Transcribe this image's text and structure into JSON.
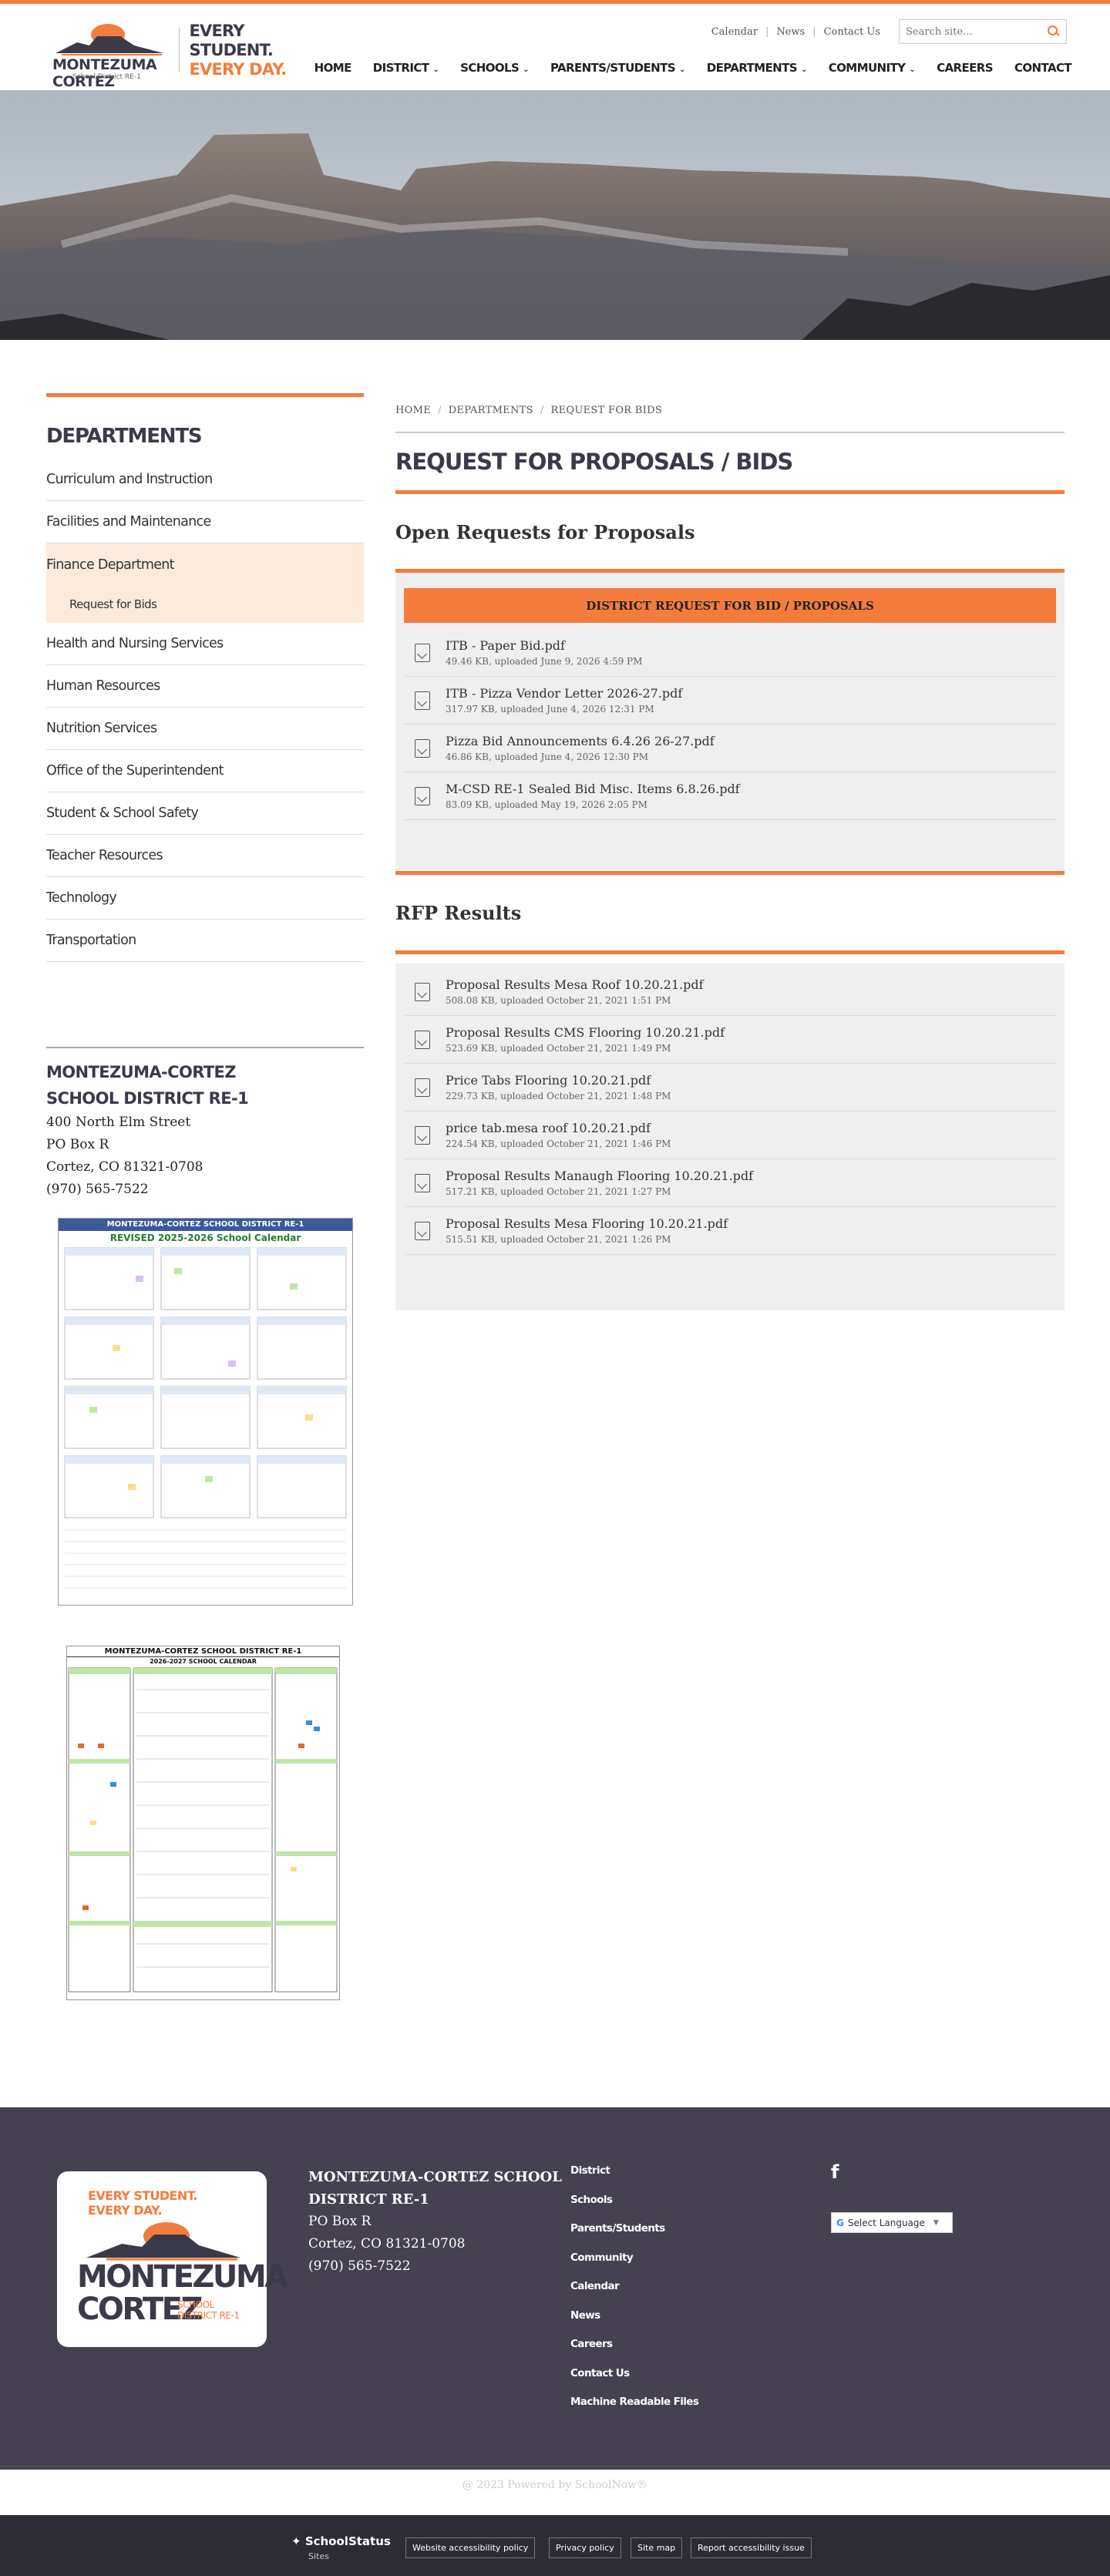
{
  "header": {
    "logo_name": "MONTEZUMA CORTEZ",
    "logo_sub": "School District RE-1",
    "tagline_1": "EVERY STUDENT.",
    "tagline_2": "EVERY DAY.",
    "util_links": [
      "Calendar",
      "News",
      "Contact Us"
    ],
    "search_placeholder": "Search site...",
    "nav": [
      {
        "label": "HOME",
        "dropdown": false
      },
      {
        "label": "DISTRICT",
        "dropdown": true
      },
      {
        "label": "SCHOOLS",
        "dropdown": true
      },
      {
        "label": "PARENTS/STUDENTS",
        "dropdown": true
      },
      {
        "label": "DEPARTMENTS",
        "dropdown": true
      },
      {
        "label": "COMMUNITY",
        "dropdown": true
      },
      {
        "label": "CAREERS",
        "dropdown": false
      },
      {
        "label": "CONTACT",
        "dropdown": false
      }
    ]
  },
  "breadcrumb": [
    "HOME",
    "DEPARTMENTS",
    "REQUEST FOR BIDS"
  ],
  "page_title": "REQUEST FOR PROPOSALS / BIDS",
  "open_section": {
    "heading": "Open Requests for Proposals",
    "panel_title": "DISTRICT REQUEST FOR BID / PROPOSALS",
    "files": [
      {
        "name": "ITB - Paper Bid.pdf",
        "meta": "49.46 KB, uploaded June 9, 2026 4:59 PM"
      },
      {
        "name": "ITB - Pizza Vendor Letter 2026-27.pdf",
        "meta": "317.97 KB, uploaded June 4, 2026 12:31 PM"
      },
      {
        "name": "Pizza Bid Announcements 6.4.26 26-27.pdf",
        "meta": "46.86 KB, uploaded June 4, 2026 12:30 PM"
      },
      {
        "name": "M-CSD RE-1 Sealed Bid Misc. Items 6.8.26.pdf",
        "meta": "83.09 KB, uploaded May 19, 2026 2:05 PM"
      }
    ]
  },
  "results_section": {
    "heading": "RFP Results",
    "files": [
      {
        "name": "Proposal Results Mesa Roof 10.20.21.pdf",
        "meta": "508.08 KB, uploaded October 21, 2021 1:51 PM"
      },
      {
        "name": "Proposal Results CMS Flooring 10.20.21.pdf",
        "meta": "523.69 KB, uploaded October 21, 2021 1:49 PM"
      },
      {
        "name": "Price Tabs Flooring 10.20.21.pdf",
        "meta": "229.73 KB, uploaded October 21, 2021 1:48 PM"
      },
      {
        "name": "price tab.mesa roof 10.20.21.pdf",
        "meta": "224.54 KB, uploaded October 21, 2021 1:46 PM"
      },
      {
        "name": "Proposal Results Manaugh Flooring 10.20.21.pdf",
        "meta": "517.21 KB, uploaded October 21, 2021 1:27 PM"
      },
      {
        "name": "Proposal Results Mesa Flooring 10.20.21.pdf",
        "meta": "515.51 KB, uploaded October 21, 2021 1:26 PM"
      }
    ]
  },
  "sidebar": {
    "title": "DEPARTMENTS",
    "items_before": [
      "Curriculum and Instruction",
      "Facilities and Maintenance"
    ],
    "active_item": "Finance Department",
    "active_sub": "Request for Bids",
    "items_after": [
      "Health and Nursing Services",
      "Human Resources",
      "Nutrition Services",
      "Office of the Superintendent",
      "Student & School Safety",
      "Teacher Resources",
      "Technology",
      "Transportation"
    ],
    "address_title_1": "MONTEZUMA-CORTEZ",
    "address_title_2": "SCHOOL DISTRICT RE-1",
    "address_lines": [
      "400 North Elm Street",
      "PO Box R",
      "Cortez, CO 81321-0708",
      "(970) 565-7522"
    ]
  },
  "calendar1": {
    "title": "MONTEZUMA-CORTEZ SCHOOL DISTRICT RE-1",
    "subtitle": "REVISED 2025-2026 School Calendar"
  },
  "calendar2": {
    "title": "MONTEZUMA-CORTEZ SCHOOL DISTRICT RE-1",
    "subtitle": "2026-2027 SCHOOL CALENDAR"
  },
  "footer": {
    "logo_tagline_1": "EVERY STUDENT.",
    "logo_tagline_2": "EVERY DAY.",
    "logo_word_1": "MONTEZUMA",
    "logo_word_2": "CORTEZ",
    "logo_side_1": "SCHOOL",
    "logo_side_2": "DISTRICT RE-1",
    "address_title_1": "MONTEZUMA-CORTEZ SCHOOL",
    "address_title_2": "DISTRICT RE-1",
    "address_lines": [
      "PO Box R",
      "Cortez, CO 81321-0708",
      "(970) 565-7522"
    ],
    "links": [
      "District",
      "Schools",
      "Parents/Students",
      "Community",
      "Calendar",
      "News",
      "Careers",
      "Contact Us",
      "Machine Readable Files"
    ],
    "language_label": "Select Language",
    "powered": "@ 2023 Powered by SchoolNow®",
    "ss_logo": "SchoolStatus",
    "ss_sub": "Sites",
    "bottom_buttons": [
      "Website accessibility policy",
      "Privacy policy",
      "Site map",
      "Report accessibility issue"
    ]
  },
  "colors": {
    "accent": "#f47c3c",
    "dark": "#3a3a4a",
    "footer_bg": "#464150",
    "bottom_bg": "#2d2b33",
    "panel_bg": "#efefef",
    "active_bg": "#fcebdc"
  },
  "icons": [
    "search-icon",
    "chevron-down-icon",
    "file-pdf-icon",
    "facebook-icon",
    "google-icon"
  ]
}
